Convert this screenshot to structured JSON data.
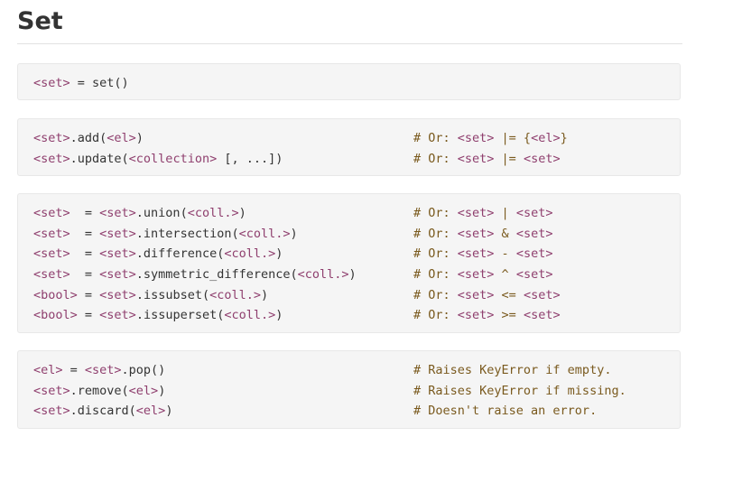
{
  "title": "Set",
  "blocks": [
    {
      "lines": [
        {
          "code": "<set> = set()",
          "comment": ""
        }
      ]
    },
    {
      "lines": [
        {
          "code": "<set>.add(<el>)",
          "comment": "# Or: <set> |= {<el>}"
        },
        {
          "code": "<set>.update(<collection> [, ...])",
          "comment": "# Or: <set> |= <set>"
        }
      ]
    },
    {
      "lines": [
        {
          "code": "<set>  = <set>.union(<coll.>)",
          "comment": "# Or: <set> | <set>"
        },
        {
          "code": "<set>  = <set>.intersection(<coll.>)",
          "comment": "# Or: <set> & <set>"
        },
        {
          "code": "<set>  = <set>.difference(<coll.>)",
          "comment": "# Or: <set> - <set>"
        },
        {
          "code": "<set>  = <set>.symmetric_difference(<coll.>)",
          "comment": "# Or: <set> ^ <set>"
        },
        {
          "code": "<bool> = <set>.issubset(<coll.>)",
          "comment": "# Or: <set> <= <set>"
        },
        {
          "code": "<bool> = <set>.issuperset(<coll.>)",
          "comment": "# Or: <set> >= <set>"
        }
      ]
    },
    {
      "lines": [
        {
          "code": "<el> = <set>.pop()",
          "comment": "# Raises KeyError if empty."
        },
        {
          "code": "<set>.remove(<el>)",
          "comment": "# Raises KeyError if missing."
        },
        {
          "code": "<set>.discard(<el>)",
          "comment": "# Doesn't raise an error."
        }
      ]
    }
  ]
}
